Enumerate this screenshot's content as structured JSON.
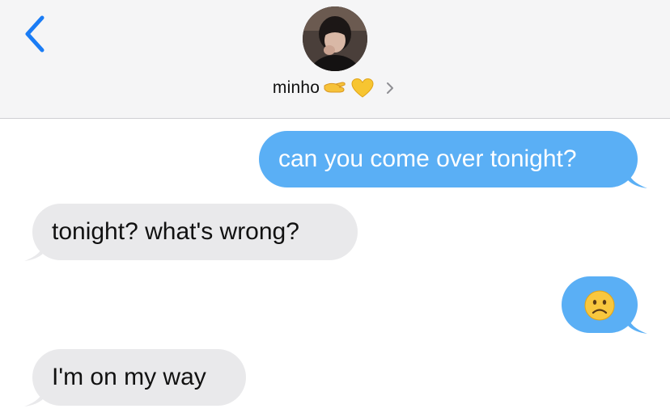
{
  "header": {
    "contact_name": "minho",
    "emoji_icons": [
      "pinching-hand-emoji-icon",
      "yellow-heart-emoji-icon"
    ]
  },
  "colors": {
    "sent_bubble": "#5aaff5",
    "received_bubble": "#e9e9eb",
    "back_accent": "#1a7cf5",
    "header_background": "#f5f5f6"
  },
  "messages": [
    {
      "direction": "sent",
      "text": "can you come over tonight?"
    },
    {
      "direction": "received",
      "text": "tonight? what's wrong?"
    },
    {
      "direction": "sent",
      "text": "☹️"
    },
    {
      "direction": "received",
      "text": "I'm on my way"
    }
  ]
}
